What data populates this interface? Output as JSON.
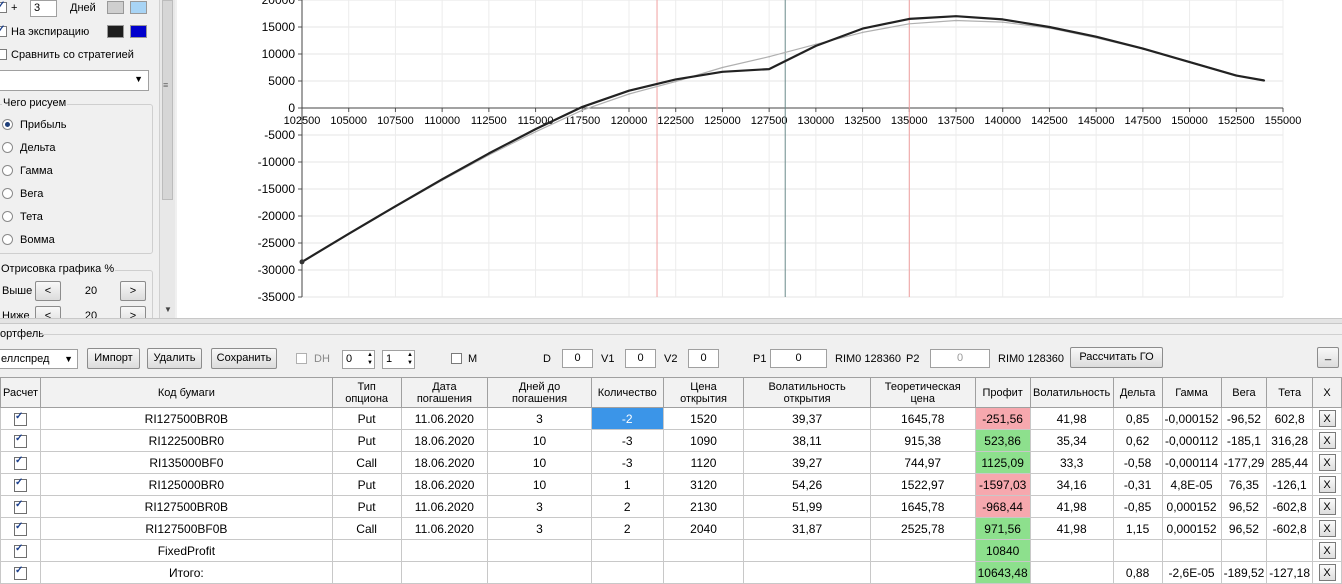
{
  "left_panel": {
    "plus_label": "+",
    "days_value": "3",
    "days_label": "Дней",
    "expiry_label": "На экспирацию",
    "compare_label": "Сравнить со стратегией",
    "draw_group_title": "Чего рисуем",
    "draw_options": [
      "Прибыль",
      "Дельта",
      "Гамма",
      "Вега",
      "Тета",
      "Вомма"
    ],
    "draw_selected": "Прибыль",
    "drawing_title": "Отрисовка графика %",
    "above_label": "Выше",
    "above_value": "20",
    "below_label": "Ниже",
    "below_value": "20",
    "prev_glyph": "<",
    "next_glyph": ">",
    "colors": {
      "days_line": "#cfcfcf",
      "days_alt": "#a8d4f5",
      "expiry_line": "#1e1e1e",
      "expiry_alt": "#0000cc"
    }
  },
  "chart_data": {
    "type": "line",
    "xlim": [
      102500,
      155000
    ],
    "ylim": [
      -35000,
      20000
    ],
    "x_ticks": [
      "102500",
      "105000",
      "107500",
      "110000",
      "112500",
      "115000",
      "117500",
      "120000",
      "122500",
      "125000",
      "127500",
      "130000",
      "132500",
      "135000",
      "137500",
      "140000",
      "142500",
      "145000",
      "147500",
      "150000",
      "152500",
      "155000"
    ],
    "y_ticks": [
      "20000",
      "15000",
      "10000",
      "5000",
      "0",
      "-5000",
      "-10000",
      "-15000",
      "-20000",
      "-25000",
      "-30000",
      "-35000"
    ],
    "vlines": [
      {
        "x": 121500,
        "color": "#f0a0a0"
      },
      {
        "x": 128360,
        "color": "#6a8a8a"
      },
      {
        "x": 135000,
        "color": "#f0a0a0"
      }
    ],
    "series": [
      {
        "color": "#222222",
        "x": [
          102500,
          105000,
          107500,
          110000,
          112500,
          115000,
          117500,
          120000,
          122500,
          125000,
          127500,
          130000,
          132500,
          135000,
          137500,
          140000,
          142500,
          145000,
          147500,
          150000,
          152500,
          154000
        ],
        "y": [
          -28500,
          -23300,
          -18200,
          -13200,
          -8400,
          -3900,
          200,
          3200,
          5300,
          6700,
          7200,
          11500,
          14700,
          16500,
          17000,
          16400,
          15000,
          13200,
          11000,
          8500,
          6000,
          5100
        ]
      },
      {
        "color": "#b0b0b0",
        "x": [
          102500,
          105000,
          107500,
          110000,
          112500,
          115000,
          117500,
          120000,
          122500,
          125000,
          127500,
          130000,
          132500,
          135000,
          137500,
          140000,
          142500,
          145000,
          147500,
          150000,
          152500,
          154000
        ],
        "y": [
          -28500,
          -23300,
          -18300,
          -13400,
          -8700,
          -4400,
          -400,
          2600,
          4900,
          7500,
          9500,
          11800,
          14000,
          15600,
          16200,
          15900,
          14800,
          13000,
          10900,
          8600,
          6100,
          5000
        ]
      }
    ]
  },
  "toolbar": {
    "section_title": "ортфель",
    "strategy_value": "еллспред",
    "import_label": "Импорт",
    "delete_label": "Удалить",
    "save_label": "Сохранить",
    "dh_label": "DH",
    "spin1_value": "0",
    "spin2_value": "1",
    "m_label": "M",
    "d_label": "D",
    "d_value": "0",
    "v1_label": "V1",
    "v1_value": "0",
    "v2_label": "V2",
    "v2_value": "0",
    "p1_label": "P1",
    "p1_value": "0",
    "rim1_label": "RIM0 128360",
    "p2_label": "P2",
    "p2_value": "0",
    "rim2_label": "RIM0 128360",
    "calc_label": "Рассчитать ГО",
    "min_label": "_"
  },
  "table": {
    "headers": [
      "Расчет",
      "Код бумаги",
      "Тип опциона",
      "Дата погашения",
      "Дней до погашения",
      "Количество",
      "Цена открытия",
      "Волатильность открытия",
      "Теоретическая цена",
      "Профит",
      "Волатильность",
      "Дельта",
      "Гамма",
      "Вега",
      "Тета",
      "X"
    ],
    "rows": [
      {
        "code": "RI127500BR0B",
        "type": "Put",
        "date": "11.06.2020",
        "days": "3",
        "qty": "-2",
        "price": "1520",
        "vol_open": "39,37",
        "theo": "1645,78",
        "profit": "-251,56",
        "vol": "41,98",
        "delta": "0,85",
        "gamma": "-0,000152",
        "vega": "-96,52",
        "theta": "602,8",
        "x": "X"
      },
      {
        "code": "RI122500BR0",
        "type": "Put",
        "date": "18.06.2020",
        "days": "10",
        "qty": "-3",
        "price": "1090",
        "vol_open": "38,11",
        "theo": "915,38",
        "profit": "523,86",
        "vol": "35,34",
        "delta": "0,62",
        "gamma": "-0,000112",
        "vega": "-185,1",
        "theta": "316,28",
        "x": "X"
      },
      {
        "code": "RI135000BF0",
        "type": "Call",
        "date": "18.06.2020",
        "days": "10",
        "qty": "-3",
        "price": "1120",
        "vol_open": "39,27",
        "theo": "744,97",
        "profit": "1125,09",
        "vol": "33,3",
        "delta": "-0,58",
        "gamma": "-0,000114",
        "vega": "-177,29",
        "theta": "285,44",
        "x": "X"
      },
      {
        "code": "RI125000BR0",
        "type": "Put",
        "date": "18.06.2020",
        "days": "10",
        "qty": "1",
        "price": "3120",
        "vol_open": "54,26",
        "theo": "1522,97",
        "profit": "-1597,03",
        "vol": "34,16",
        "delta": "-0,31",
        "gamma": "4,8E-05",
        "vega": "76,35",
        "theta": "-126,1",
        "x": "X"
      },
      {
        "code": "RI127500BR0B",
        "type": "Put",
        "date": "11.06.2020",
        "days": "3",
        "qty": "2",
        "price": "2130",
        "vol_open": "51,99",
        "theo": "1645,78",
        "profit": "-968,44",
        "vol": "41,98",
        "delta": "-0,85",
        "gamma": "0,000152",
        "vega": "96,52",
        "theta": "-602,8",
        "x": "X"
      },
      {
        "code": "RI127500BF0B",
        "type": "Call",
        "date": "11.06.2020",
        "days": "3",
        "qty": "2",
        "price": "2040",
        "vol_open": "31,87",
        "theo": "2525,78",
        "profit": "971,56",
        "vol": "41,98",
        "delta": "1,15",
        "gamma": "0,000152",
        "vega": "96,52",
        "theta": "-602,8",
        "x": "X"
      },
      {
        "code": "FixedProfit",
        "type": "",
        "date": "",
        "days": "",
        "qty": "",
        "price": "",
        "vol_open": "",
        "theo": "",
        "profit": "10840",
        "vol": "",
        "delta": "",
        "gamma": "",
        "vega": "",
        "theta": "",
        "x": "X"
      },
      {
        "code": "Итого:",
        "type": "",
        "date": "",
        "days": "",
        "qty": "",
        "price": "",
        "vol_open": "",
        "theo": "",
        "profit": "10643,48",
        "vol": "",
        "delta": "0,88",
        "gamma": "-2,6E-05",
        "vega": "-189,52",
        "theta": "-127,18",
        "x": "X"
      }
    ],
    "colors": {
      "profit_positive": "#8de08d",
      "profit_negative": "#f6a8ae",
      "selected_cell": "#3b95e8"
    }
  }
}
